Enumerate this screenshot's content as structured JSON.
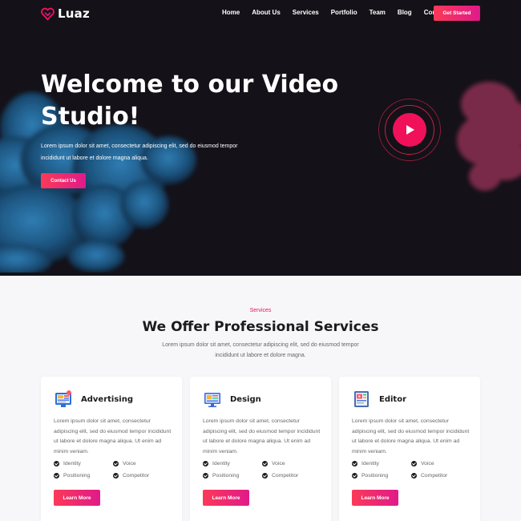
{
  "brand": {
    "name": "Luaz"
  },
  "nav": {
    "items": [
      "Home",
      "About Us",
      "Services",
      "Portfolio",
      "Team",
      "Blog",
      "Contact Us"
    ],
    "cta": "Get Started"
  },
  "hero": {
    "title": "Welcome to our Video Studio!",
    "text": "Lorem ipsum dolor sit amet, consectetur adipiscing elit, sed do eiusmod tempor incididunt ut labore et dolore magna aliqua.",
    "cta": "Contact Us"
  },
  "services": {
    "tag": "Services",
    "title": "We Offer Professional Services",
    "text": "Lorem ipsum dolor sit amet, consectetur adipiscing elit, sed do eiusmod tempor incididunt ut labore et dolore magna.",
    "cards": [
      {
        "title": "Advertising",
        "icon": "advertising-icon",
        "text": "Lorem ipsum dolor sit amet, consectetur adipiscing elit, sed do eiusmod tempor incididunt ut labore et dolore magna aliqua. Ut enim ad minim veniam.",
        "features": [
          "Identity",
          "Voice",
          "Positioning",
          "Competitor"
        ],
        "button": "Learn More"
      },
      {
        "title": "Design",
        "icon": "design-icon",
        "text": "Lorem ipsum dolor sit amet, consectetur adipiscing elit, sed do eiusmod tempor incididunt ut labore et dolore magna aliqua. Ut enim ad minim veniam.",
        "features": [
          "Identity",
          "Voice",
          "Positioning",
          "Competitor"
        ],
        "button": "Learn More"
      },
      {
        "title": "Editor",
        "icon": "editor-icon",
        "text": "Lorem ipsum dolor sit amet, consectetur adipiscing elit, sed do eiusmod tempor incididunt ut labore et dolore magna aliqua. Ut enim ad minim veniam.",
        "features": [
          "Identity",
          "Voice",
          "Positioning",
          "Competitor"
        ],
        "button": "Learn More"
      }
    ]
  },
  "colors": {
    "accent": "#f0115a",
    "gradient_start": "#fb3a57",
    "gradient_end": "#e01a8a",
    "hero_bg": "#141118"
  }
}
